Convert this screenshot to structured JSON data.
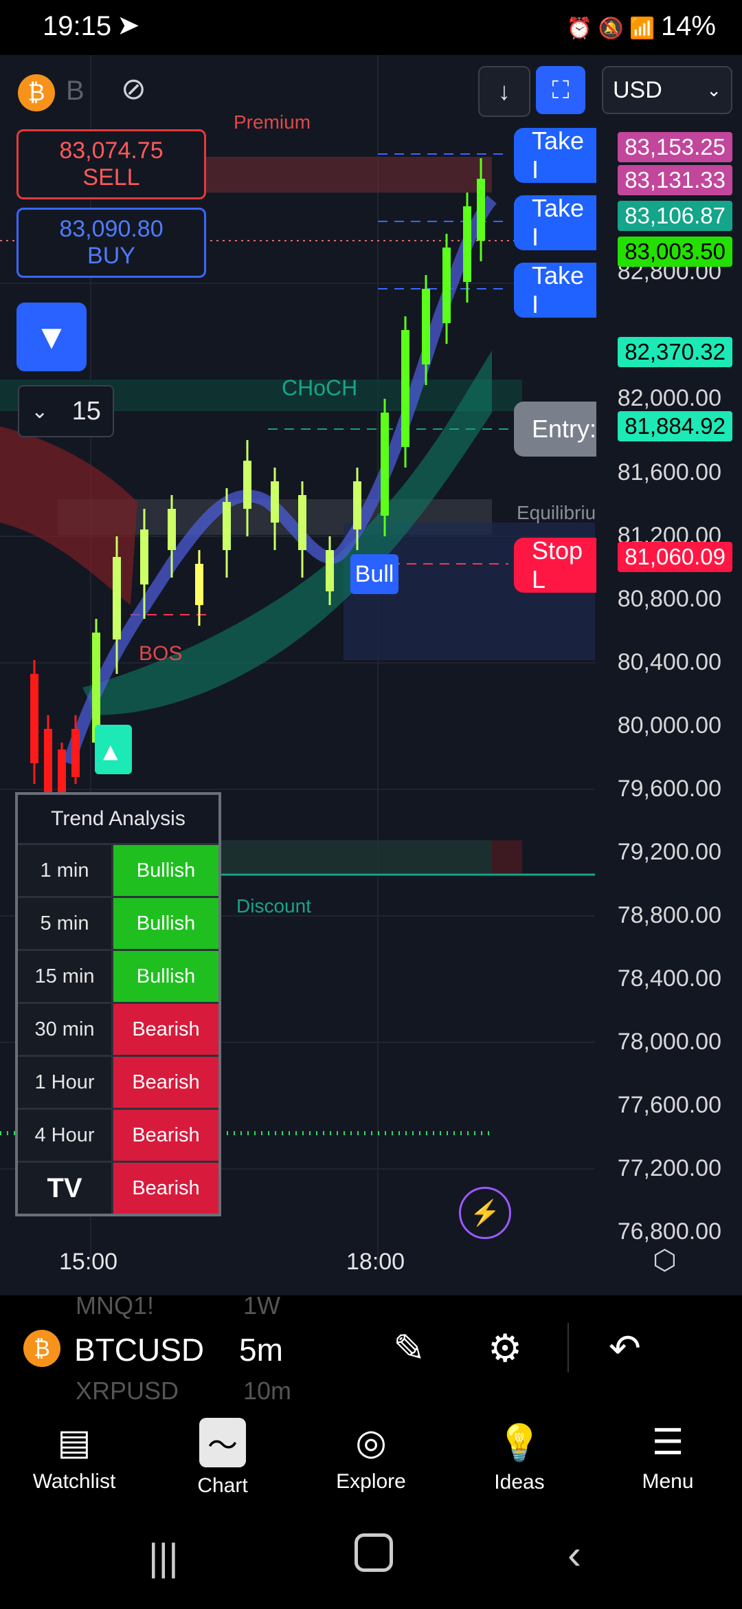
{
  "status": {
    "time": "19:15",
    "battery": "14%"
  },
  "toolbar": {
    "currency": "USD",
    "symbol_letter": "B"
  },
  "order": {
    "sell_price": "83,074.75",
    "sell_label": "SELL",
    "buy_price": "83,090.80",
    "buy_label": "BUY"
  },
  "interval_selector": {
    "value": "15"
  },
  "chart_labels": {
    "premium": "Premium",
    "choch": "CHoCH",
    "equilibrium": "Equilibriu",
    "bull": "Bull",
    "bos": "BOS",
    "discount": "Discount"
  },
  "right_tags": {
    "take1": "Take I",
    "take2": "Take I",
    "take3": "Take I",
    "entry": "Entry:",
    "stop": "Stop L"
  },
  "price_tags": [
    {
      "value": "83,153.25",
      "color": "#c2469b"
    },
    {
      "value": "83,131.33",
      "color": "#c2469b"
    },
    {
      "value": "83,106.87",
      "color": "#14a58a"
    },
    {
      "value": "83,003.50",
      "color": "#23e000"
    },
    {
      "value": "82,370.32",
      "color": "#1de9b6"
    },
    {
      "value": "81,884.92",
      "color": "#1de9b6"
    },
    {
      "value": "81,060.09",
      "color": "#ff1744"
    }
  ],
  "y_axis": [
    "82,800.00",
    "82,000.00",
    "81,600.00",
    "81,200.00",
    "80,800.00",
    "80,400.00",
    "80,000.00",
    "79,600.00",
    "79,200.00",
    "78,800.00",
    "78,400.00",
    "78,000.00",
    "77,600.00",
    "77,200.00",
    "76,800.00"
  ],
  "x_axis": [
    "15:00",
    "18:00"
  ],
  "trend": {
    "title": "Trend Analysis",
    "rows": [
      {
        "tf": "1 min",
        "state": "Bullish",
        "color": "#1fbf1f"
      },
      {
        "tf": "5 min",
        "state": "Bullish",
        "color": "#1fbf1f"
      },
      {
        "tf": "15 min",
        "state": "Bullish",
        "color": "#1fbf1f"
      },
      {
        "tf": "30 min",
        "state": "Bearish",
        "color": "#d81b3c"
      },
      {
        "tf": "1 Hour",
        "state": "Bearish",
        "color": "#d81b3c"
      },
      {
        "tf": "4 Hour",
        "state": "Bearish",
        "color": "#d81b3c"
      },
      {
        "tf": "",
        "state": "Bearish",
        "color": "#d81b3c"
      }
    ]
  },
  "symbol_bar": {
    "symbol": "BTCUSD",
    "interval": "5m",
    "ghost_above_symbol": "MNQ1!",
    "ghost_above_interval": "1W",
    "ghost_below_symbol": "XRPUSD",
    "ghost_below_interval": "10m"
  },
  "bottom_nav": [
    {
      "label": "Watchlist",
      "icon": "watchlist-icon"
    },
    {
      "label": "Chart",
      "icon": "chart-icon"
    },
    {
      "label": "Explore",
      "icon": "compass-icon"
    },
    {
      "label": "Ideas",
      "icon": "lightbulb-icon"
    },
    {
      "label": "Menu",
      "icon": "menu-icon"
    }
  ]
}
